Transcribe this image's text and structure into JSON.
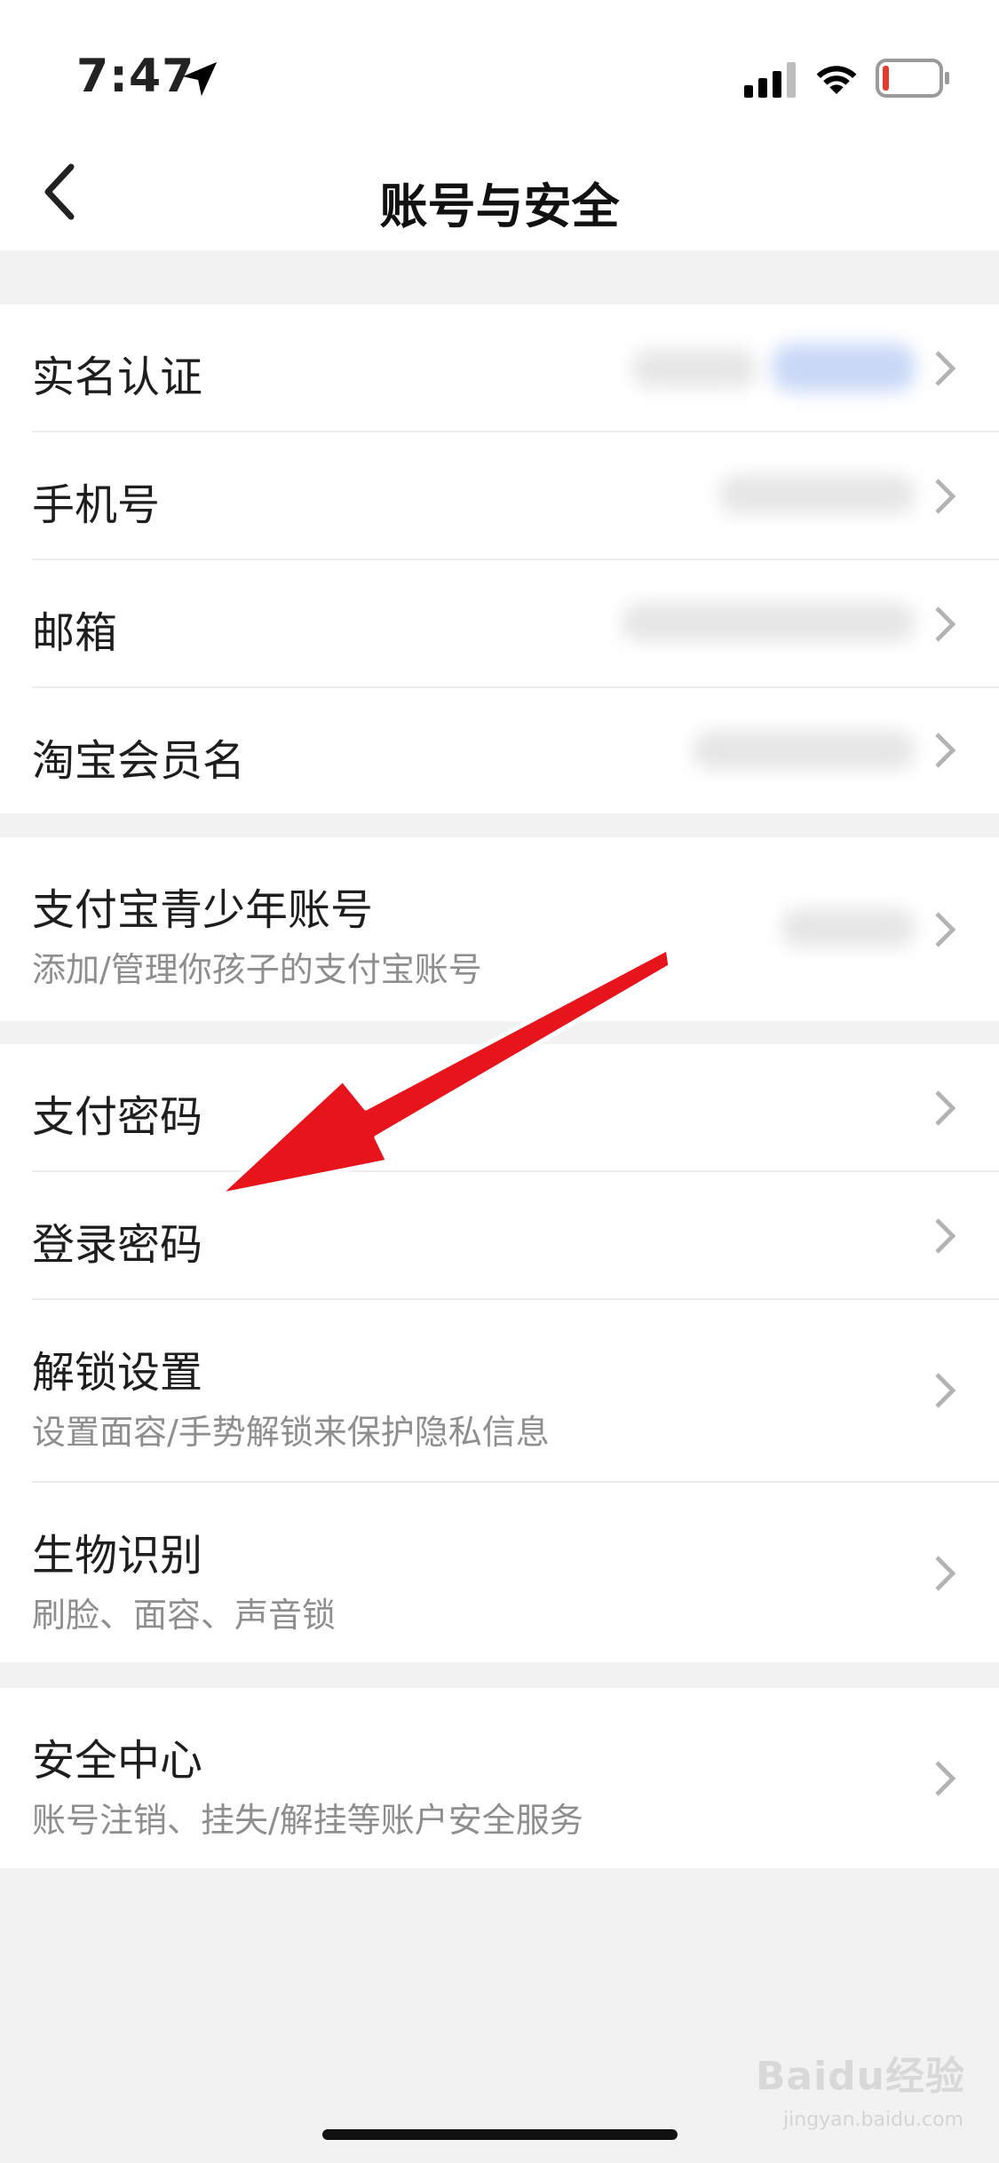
{
  "status_bar": {
    "time": "7:47",
    "colors": {
      "battery_low": "#e33b2e"
    }
  },
  "nav": {
    "title": "账号与安全",
    "back_icon": "chevron-left-icon"
  },
  "groups": [
    {
      "items": [
        {
          "title": "实名认证",
          "value_blurred": true
        },
        {
          "title": "手机号",
          "value_blurred": true
        },
        {
          "title": "邮箱",
          "value_blurred": true
        },
        {
          "title": "淘宝会员名",
          "value_blurred": true
        }
      ]
    },
    {
      "items": [
        {
          "title": "支付宝青少年账号",
          "subtitle": "添加/管理你孩子的支付宝账号",
          "value_blurred": true
        }
      ]
    },
    {
      "items": [
        {
          "title": "支付密码"
        },
        {
          "title": "登录密码"
        },
        {
          "title": "解锁设置",
          "subtitle": "设置面容/手势解锁来保护隐私信息"
        },
        {
          "title": "生物识别",
          "subtitle": "刷脸、面容、声音锁"
        }
      ]
    },
    {
      "items": [
        {
          "title": "安全中心",
          "subtitle": "账号注销、挂失/解挂等账户安全服务"
        }
      ]
    }
  ],
  "annotation": {
    "type": "red-arrow",
    "points_to": "登录密码",
    "color": "#e8141b"
  },
  "watermark": {
    "brand": "Baidu经验",
    "url": "jingyan.baidu.com"
  }
}
